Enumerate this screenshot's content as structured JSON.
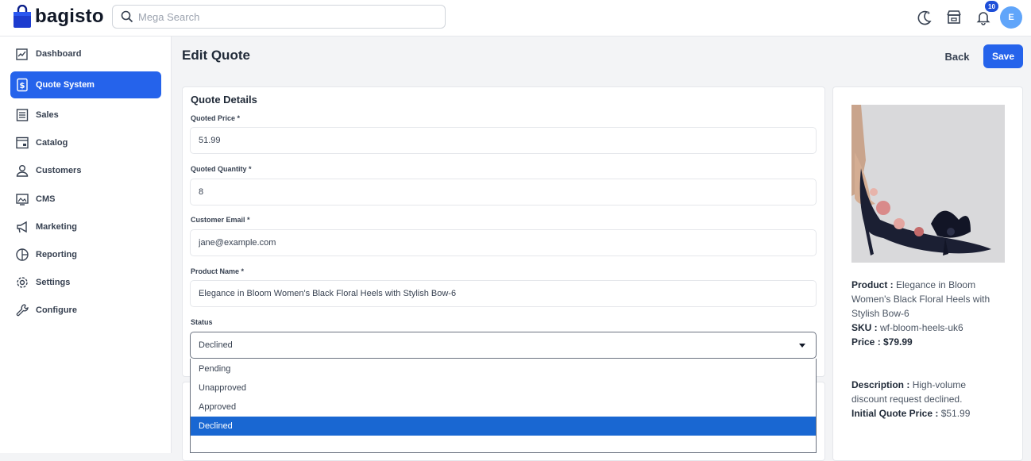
{
  "brand": {
    "name": "bagisto"
  },
  "search": {
    "placeholder": "Mega Search"
  },
  "header": {
    "notification_count": "10",
    "avatar_initial": "E"
  },
  "sidebar": {
    "items": [
      {
        "label": "Dashboard",
        "icon": "dashboard-icon"
      },
      {
        "label": "Quote System",
        "icon": "dollar-doc-icon",
        "active": true
      },
      {
        "label": "Sales",
        "icon": "list-icon"
      },
      {
        "label": "Catalog",
        "icon": "catalog-icon"
      },
      {
        "label": "Customers",
        "icon": "person-icon"
      },
      {
        "label": "CMS",
        "icon": "monitor-icon"
      },
      {
        "label": "Marketing",
        "icon": "megaphone-icon"
      },
      {
        "label": "Reporting",
        "icon": "pie-chart-icon"
      },
      {
        "label": "Settings",
        "icon": "gear-icon"
      },
      {
        "label": "Configure",
        "icon": "wrench-icon"
      }
    ]
  },
  "page": {
    "title": "Edit Quote",
    "back_label": "Back",
    "save_label": "Save"
  },
  "form": {
    "title": "Quote Details",
    "quoted_price": {
      "label": "Quoted Price *",
      "value": "51.99"
    },
    "quoted_quantity": {
      "label": "Quoted Quantity *",
      "value": "8"
    },
    "customer_email": {
      "label": "Customer Email *",
      "value": "jane@example.com"
    },
    "product_name": {
      "label": "Product Name *",
      "value": "Elegance in Bloom Women's Black Floral Heels with Stylish Bow-6"
    },
    "status": {
      "label": "Status",
      "value": "Declined",
      "options": [
        "Pending",
        "Unapproved",
        "Approved",
        "Declined"
      ]
    }
  },
  "product": {
    "product_label": "Product :",
    "product_value": "Elegance in Bloom Women's Black Floral Heels with Stylish Bow-6",
    "sku_label": "SKU :",
    "sku_value": "wf-bloom-heels-uk6",
    "price_label": "Price :",
    "price_value": "$79.99",
    "description_label": "Description :",
    "description_value": "High-volume discount request declined.",
    "initial_quote_label": "Initial Quote Price :",
    "initial_quote_value": "$51.99"
  },
  "colors": {
    "accent": "#2563eb",
    "selected_option": "#1967d2"
  }
}
